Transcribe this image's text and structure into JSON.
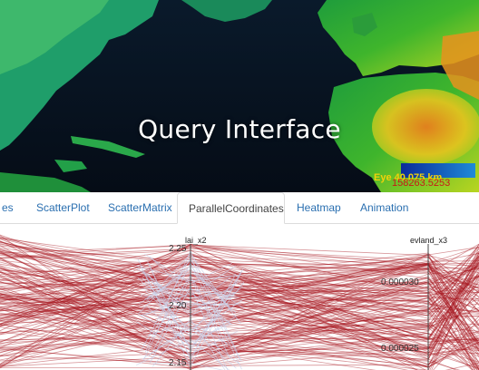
{
  "map": {
    "title": "Query Interface",
    "eye_readout": "Eye 4",
    "eye_value": "0,075 km",
    "coord_readout": "158263.5253"
  },
  "tabs": [
    {
      "label": "es"
    },
    {
      "label": "ScatterPlot"
    },
    {
      "label": "ScatterMatrix"
    },
    {
      "label": "ParallelCoordinates",
      "active": true
    },
    {
      "label": "Heatmap"
    },
    {
      "label": "Animation"
    }
  ],
  "chart_data": {
    "type": "parallel_coordinates",
    "axes": [
      {
        "name": "lai_x2",
        "ticks": [
          2.25,
          2.2,
          2.15
        ],
        "tick_labels": [
          "2.25",
          "2.20",
          "2.15"
        ]
      },
      {
        "name": "evland_x3",
        "ticks": [
          3e-05,
          2.5e-05
        ],
        "tick_labels": [
          "0.000030",
          "0.000025"
        ]
      }
    ],
    "line_color": "#a6141c",
    "highlight_color": "#c9d2ea"
  }
}
